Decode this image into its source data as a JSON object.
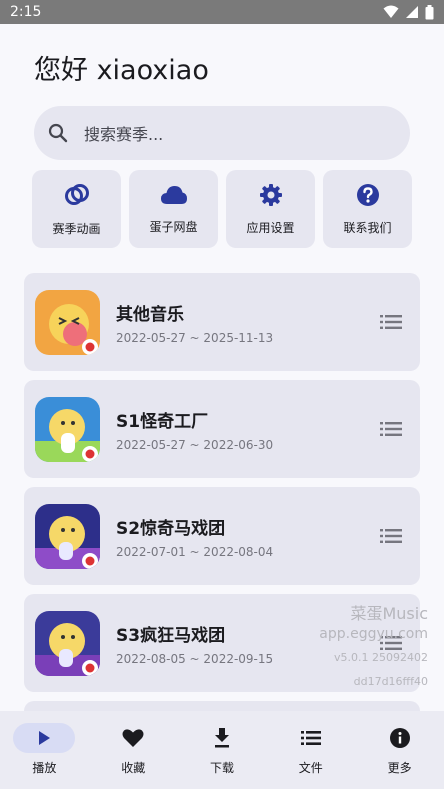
{
  "status_bar": {
    "time": "2:15"
  },
  "greeting": "您好 xiaoxiao",
  "search": {
    "placeholder": "搜索赛季..."
  },
  "shortcuts": [
    {
      "label": "赛季动画",
      "icon": "rings-icon"
    },
    {
      "label": "蛋子网盘",
      "icon": "cloud-icon"
    },
    {
      "label": "应用设置",
      "icon": "gear-icon"
    },
    {
      "label": "联系我们",
      "icon": "help-icon"
    }
  ],
  "seasons": [
    {
      "title": "其他音乐",
      "date": "2022-05-27 ~ 2025-11-13"
    },
    {
      "title": "S1怪奇工厂",
      "date": "2022-05-27 ~ 2022-06-30"
    },
    {
      "title": "S2惊奇马戏团",
      "date": "2022-07-01 ~ 2022-08-04"
    },
    {
      "title": "S3疯狂马戏团",
      "date": "2022-08-05 ~ 2022-09-15"
    }
  ],
  "watermark": {
    "app_name": "菜蛋Music",
    "site": "app.eggyu.com",
    "version": "v5.0.1 25092402",
    "hash": "dd17d16fff40"
  },
  "nav": [
    {
      "label": "播放",
      "icon": "play-icon",
      "active": true
    },
    {
      "label": "收藏",
      "icon": "heart-icon",
      "active": false
    },
    {
      "label": "下载",
      "icon": "download-icon",
      "active": false
    },
    {
      "label": "文件",
      "icon": "list-icon",
      "active": false
    },
    {
      "label": "更多",
      "icon": "info-icon",
      "active": false
    }
  ],
  "colors": {
    "accent": "#2b3a9e",
    "card": "#e6e6f0",
    "background": "#f8f8fc"
  }
}
